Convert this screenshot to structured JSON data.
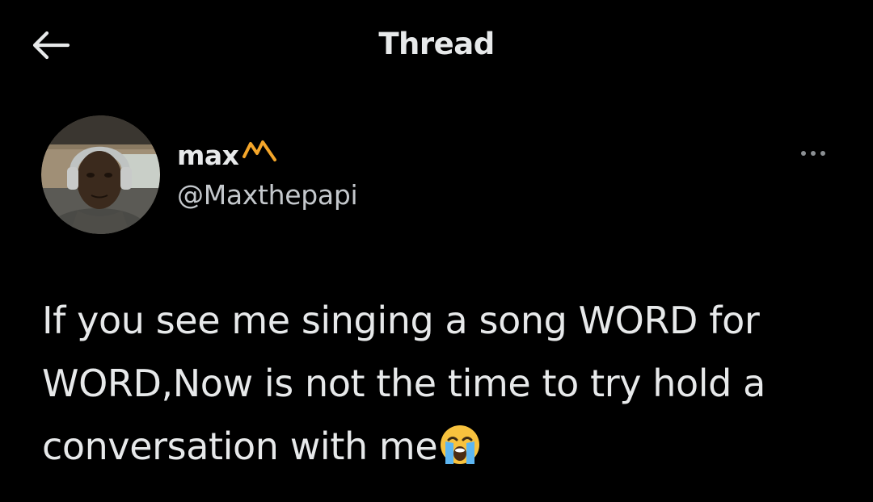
{
  "header": {
    "back_icon": "arrow-left-icon",
    "title": "Thread"
  },
  "tweet": {
    "author": {
      "display_name": "max",
      "name_badge_icon": "crown-icon",
      "badge_color": "#f4a62a",
      "handle": "@Maxthepapi"
    },
    "more_icon": "ellipsis-icon",
    "text": "If you see me singing a song WORD for WORD,Now is not the time to try hold a conversation with me",
    "emoji": "loudly-crying-face"
  },
  "colors": {
    "background": "#000000",
    "text_primary": "#e7e9ea",
    "text_secondary": "#c4c8cc"
  }
}
